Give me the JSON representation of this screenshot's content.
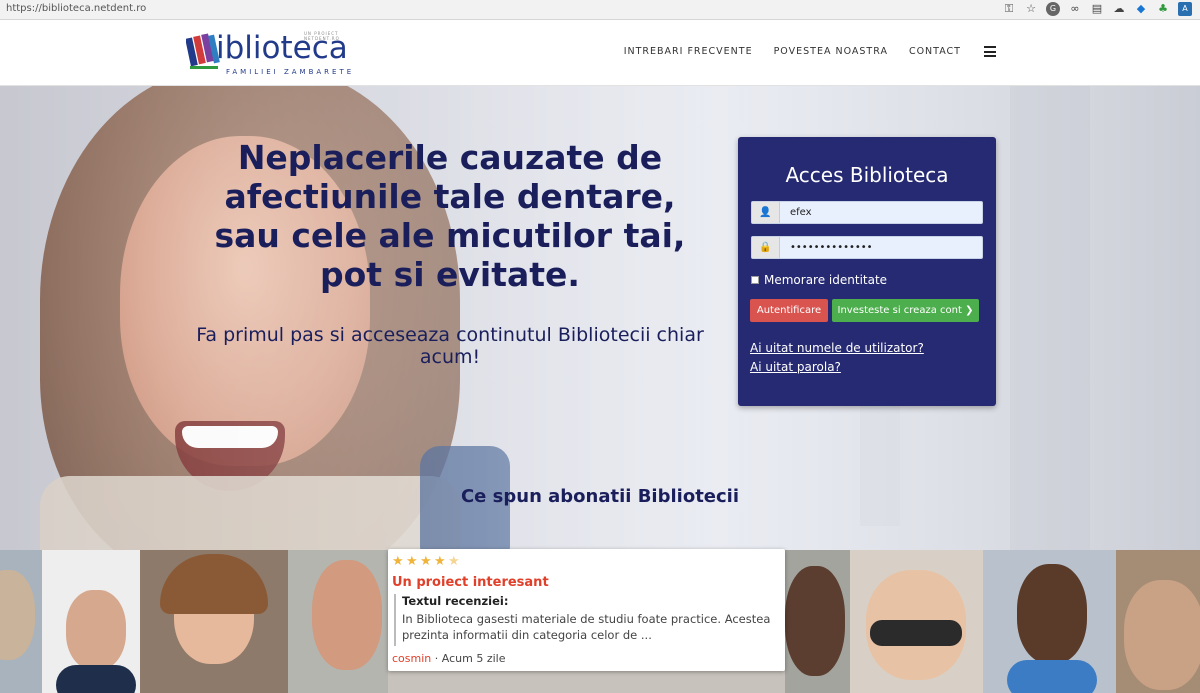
{
  "browser": {
    "url": "https://biblioteca.netdent.ro",
    "icons": [
      "key-icon",
      "star-icon",
      "g-extension-icon",
      "link-extension-icon",
      "chat-extension-icon",
      "cloud-extension-icon",
      "dropbox-icon",
      "evernote-icon",
      "translate-extension-icon"
    ]
  },
  "header": {
    "logo_word": "iblioteca",
    "logo_sub": "FAMILIEI ZAMBARETE",
    "logo_tiny": "UN PROIECT NETDENT.RO",
    "nav": [
      "INTREBARI FRECVENTE",
      "POVESTEA NOASTRA",
      "CONTACT"
    ]
  },
  "hero": {
    "headline": "Neplacerile cauzate de afectiunile tale dentare, sau cele ale micutilor tai, pot si evitate.",
    "subline": "Fa primul pas si acceseaza continutul Bibliotecii chiar acum!"
  },
  "login": {
    "title": "Acces Biblioteca",
    "username": "efex",
    "password": "••••••••••••••",
    "remember_label": "Memorare identitate",
    "login_button": "Autentificare",
    "create_button": "Investeste si creaza cont",
    "forgot_username": "Ai uitat numele de utilizator?",
    "forgot_password": "Ai uitat parola?"
  },
  "testimonials": {
    "title": "Ce spun abonatii Bibliotecii",
    "review": {
      "rating": 4.5,
      "title": "Un proiect interesant",
      "label": "Textul recenziei:",
      "body": "In Biblioteca gasesti materiale de studiu foate practice. Acestea prezinta informatii din categoria celor de ...",
      "author": "cosmin",
      "time": " · Acum 5 zile"
    }
  },
  "colors": {
    "brand": "#262a72",
    "headline": "#1a1f5c",
    "danger": "#d9534f",
    "success": "#4cae4c",
    "accent": "#e0402a"
  }
}
